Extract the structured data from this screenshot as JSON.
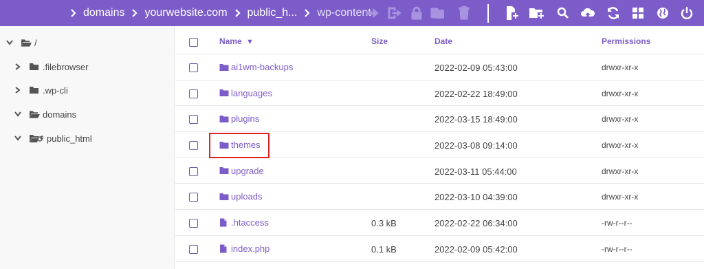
{
  "breadcrumb": [
    "domains",
    "yourwebsite.com",
    "public_h...",
    "wp-content"
  ],
  "toolbar": {
    "disabled": [
      "move-icon",
      "rename-icon",
      "lock-icon",
      "archive-icon",
      "trash-icon"
    ],
    "enabled": [
      "new-file-icon",
      "new-folder-icon",
      "search-icon",
      "upload-cloud-icon",
      "refresh-icon",
      "grid-view-icon",
      "globe-icon",
      "logout-icon"
    ]
  },
  "sidebar": {
    "items": [
      {
        "label": "/",
        "expanded": true,
        "level": 0
      },
      {
        "label": ".filebrowser",
        "expanded": false,
        "level": 1
      },
      {
        "label": ".wp-cli",
        "expanded": false,
        "level": 1
      },
      {
        "label": "domains",
        "expanded": true,
        "level": 1
      },
      {
        "label": "public_html",
        "expanded": true,
        "level": 1,
        "link": true
      }
    ]
  },
  "table": {
    "headers": {
      "name": "Name",
      "sort_indicator": "▼",
      "size": "Size",
      "date": "Date",
      "permissions": "Permissions"
    },
    "rows": [
      {
        "type": "folder",
        "name": "ai1wm-backups",
        "size": "",
        "date": "2022-02-09 05:43:00",
        "permissions": "drwxr-xr-x"
      },
      {
        "type": "folder",
        "name": "languages",
        "size": "",
        "date": "2022-02-22 18:49:00",
        "permissions": "drwxr-xr-x"
      },
      {
        "type": "folder",
        "name": "plugins",
        "size": "",
        "date": "2022-03-15 18:49:00",
        "permissions": "drwxr-xr-x"
      },
      {
        "type": "folder",
        "name": "themes",
        "size": "",
        "date": "2022-03-08 09:14:00",
        "permissions": "drwxr-xr-x"
      },
      {
        "type": "folder",
        "name": "upgrade",
        "size": "",
        "date": "2022-03-11 05:44:00",
        "permissions": "drwxr-xr-x"
      },
      {
        "type": "folder",
        "name": "uploads",
        "size": "",
        "date": "2022-03-10 04:39:00",
        "permissions": "drwxr-xr-x"
      },
      {
        "type": "file",
        "name": ".htaccess",
        "size": "0.3 kB",
        "date": "2022-02-22 06:34:00",
        "permissions": "-rw-r--r--"
      },
      {
        "type": "file",
        "name": "index.php",
        "size": "0.1 kB",
        "date": "2022-02-09 05:42:00",
        "permissions": "-rw-r--r--"
      }
    ],
    "highlighted_row": "themes"
  },
  "colors": {
    "accent": "#7c5cc9",
    "highlight": "#e0201c"
  }
}
